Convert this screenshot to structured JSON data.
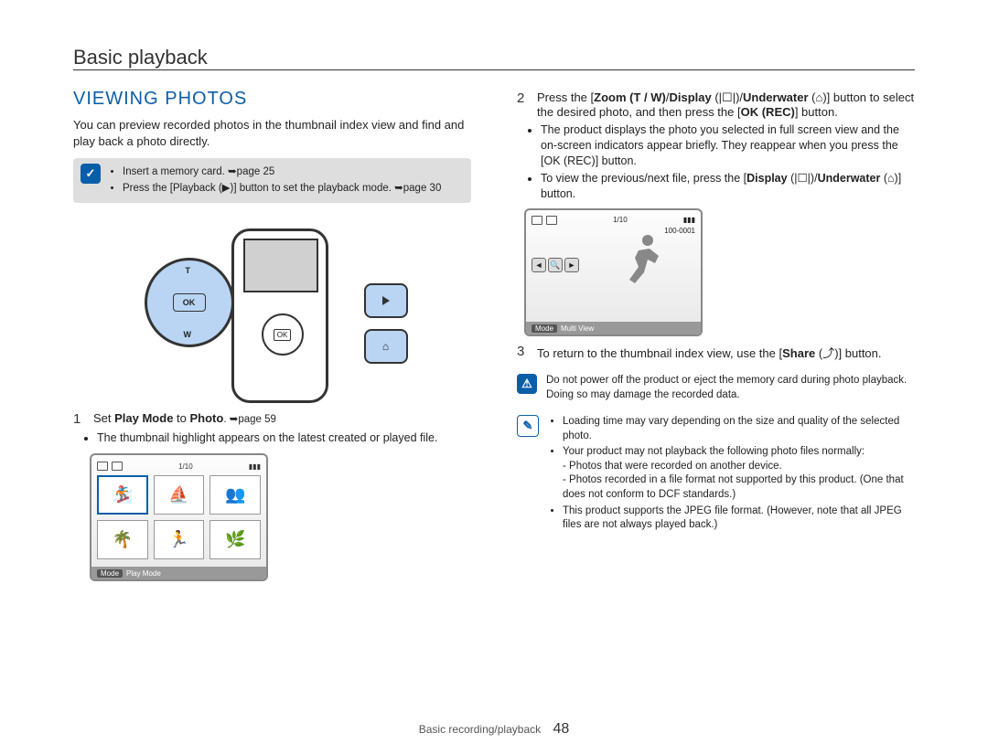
{
  "header": {
    "title": "Basic playback"
  },
  "left": {
    "heading": "VIEWING PHOTOS",
    "intro": "You can preview recorded photos in the thumbnail index view and find and play back a photo directly.",
    "tip": {
      "items": [
        "Insert a memory card. ➥page 25",
        "Press the [Playback (▶)] button to set the playback mode. ➥page 30"
      ]
    },
    "control_pad": {
      "t": "T",
      "ok": "OK",
      "w": "W"
    },
    "step1_num": "1",
    "step1_text_pre": "Set ",
    "step1_text_bold1": "Play Mode",
    "step1_text_mid": " to ",
    "step1_text_bold2": "Photo",
    "step1_text_post": ". ➥page 59",
    "step1_bullet": "The thumbnail highlight appears on the latest created or played file.",
    "lcd1": {
      "counter": "1/10",
      "bottom_mode": "Mode",
      "bottom_label": "Play Mode"
    }
  },
  "right": {
    "step2_num": "2",
    "step2_line1_a": "Press the [",
    "step2_line1_b": "Zoom (T / W)",
    "step2_line1_c": "/",
    "step2_line1_d": "Display",
    "step2_line1_e": " (|☐|)/",
    "step2_line1_f": "Underwater",
    "step2_line1_g": " (⌂)] button to select the desired photo, and then press the [",
    "step2_line1_h": "OK (REC)",
    "step2_line1_i": "] button.",
    "step2_bullets": [
      "The product displays the photo you selected in full screen view and the on-screen indicators appear briefly. They reappear when you press the [OK (REC)] button.",
      "To view the previous/next file, press the [Display (|☐|)/Underwater (⌂)] button."
    ],
    "lcd2": {
      "counter": "1/10",
      "file_no": "100-0001",
      "bottom_mode": "Mode",
      "bottom_label": "Multi View"
    },
    "step3_num": "3",
    "step3_a": "To return to the thumbnail index view, use the [",
    "step3_b": "Share",
    "step3_c": " (⤴)] button.",
    "caution": "Do not power off the product or eject the memory card during photo playback. Doing so may damage the recorded data.",
    "note_bullets": [
      "Loading time may vary depending on the size and quality of the selected photo.",
      "Your product may not playback the following photo files normally:",
      "- Photos that were recorded on another device.",
      "- Photos recorded in a file format not supported by this product. (One that does not conform to DCF standards.)",
      "This product supports the JPEG file format. (However, note that all JPEG files are not always played back.)"
    ]
  },
  "footer": {
    "section": "Basic recording/playback",
    "page": "48"
  }
}
